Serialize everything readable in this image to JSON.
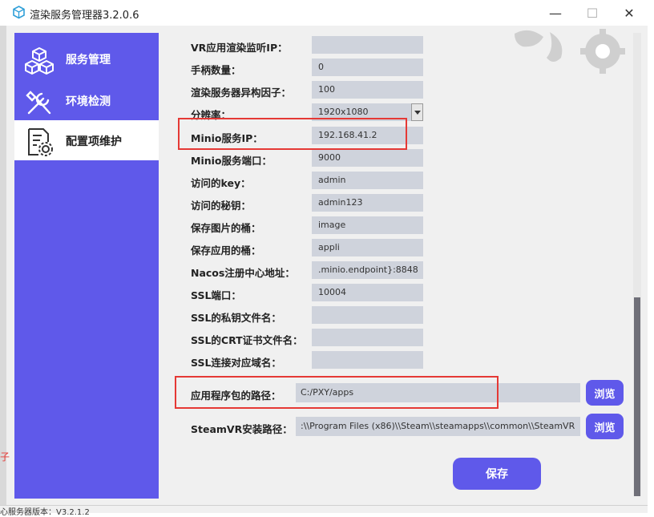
{
  "window": {
    "title": "渲染服务管理器3.2.0.6",
    "min": "—",
    "max": "☐",
    "close": "✕"
  },
  "sidebar": {
    "items": [
      {
        "label": "服务管理",
        "icon": "cubes-icon"
      },
      {
        "label": "环境检测",
        "icon": "tools-icon"
      },
      {
        "label": "配置项维护",
        "icon": "settings-doc-icon"
      }
    ]
  },
  "form": {
    "rows": [
      {
        "label": "VR应用渲染监听IP：",
        "value": ""
      },
      {
        "label": "手柄数量：",
        "value": "0"
      },
      {
        "label": "渲染服务器异构因子：",
        "value": "100"
      },
      {
        "label": "分辨率：",
        "value": "1920x1080"
      },
      {
        "label": "Minio服务IP：",
        "value": "192.168.41.2"
      },
      {
        "label": "Minio服务端口：",
        "value": "9000"
      },
      {
        "label": "访问的key：",
        "value": "admin"
      },
      {
        "label": "访问的秘钥：",
        "value": "admin123"
      },
      {
        "label": "保存图片的桶：",
        "value": "image"
      },
      {
        "label": "保存应用的桶：",
        "value": "appli"
      },
      {
        "label": "Nacos注册中心地址：",
        "value": ".minio.endpoint}:8848"
      },
      {
        "label": "SSL端口：",
        "value": "10004"
      },
      {
        "label": "SSL的私钥文件名：",
        "value": ""
      },
      {
        "label": "SSL的CRT证书文件名：",
        "value": ""
      },
      {
        "label": "SSL连接对应域名：",
        "value": ""
      }
    ],
    "app_path": {
      "label": "应用程序包的路径：",
      "value": "C:/PXY/apps",
      "browse": "浏览"
    },
    "steamvr_path": {
      "label": "SteamVR安装路径：",
      "value": ":\\\\Program Files (x86)\\\\Steam\\\\steamapps\\\\common\\\\SteamVR",
      "browse": "浏览"
    },
    "save_label": "保存"
  },
  "partial": {
    "left_char": "子",
    "bottom_text": "心服务器版本：V3.2.1.2"
  },
  "colors": {
    "accent": "#5f59ea",
    "highlight": "#e53935",
    "input_bg": "#cfd3dc"
  }
}
